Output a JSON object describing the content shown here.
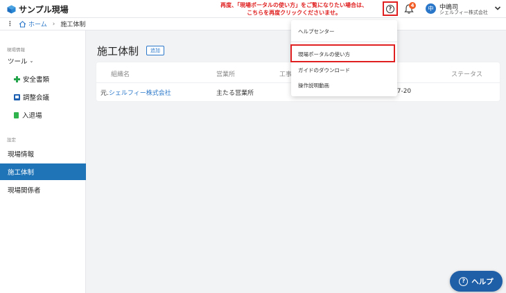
{
  "header": {
    "site_name": "サンプル現場",
    "notice_line1": "再度、「現場ポータルの使い方」をご覧になりたい場合は、",
    "notice_line2": "こちらを再度クリックくださいませ。",
    "help_icon": "help-circle-icon",
    "notification_count": "4",
    "avatar_initial": "中",
    "user_name": "中嶋司",
    "user_company": "シェルフィー株式会社"
  },
  "breadcrumb": {
    "menu_icon": "⋮",
    "home": "ホーム",
    "separator": "›",
    "current": "施工体制"
  },
  "sidebar": {
    "section1": "現場情報",
    "tools_label": "ツール",
    "tools_chevron": "⌄",
    "tools": [
      {
        "label": "安全書類",
        "icon": "plus-icon"
      },
      {
        "label": "調整会議",
        "icon": "document-icon"
      },
      {
        "label": "入退場",
        "icon": "green-tag-icon"
      }
    ],
    "section2": "設定",
    "settings": [
      {
        "label": "現場情報"
      },
      {
        "label": "施工体制"
      },
      {
        "label": "現場関係者"
      }
    ]
  },
  "main": {
    "title": "施工体制",
    "add_label": "追加",
    "columns": [
      "組織名",
      "営業所",
      "工事",
      "ステータス"
    ],
    "rows": [
      {
        "org_prefix": "元.",
        "org_name": "シェルフィー株式会社",
        "office": "主たる営業所",
        "partial": "67-20"
      }
    ]
  },
  "dropdown": {
    "items": [
      "ヘルプセンター",
      "現場ポータルの使い方",
      "ガイドのダウンロード",
      "操作説明動画"
    ]
  },
  "help_button": {
    "icon": "?",
    "label": "ヘルプ"
  },
  "colors": {
    "accent": "#2a77c9",
    "active_nav": "#1f74b8",
    "alert": "#e02020"
  }
}
